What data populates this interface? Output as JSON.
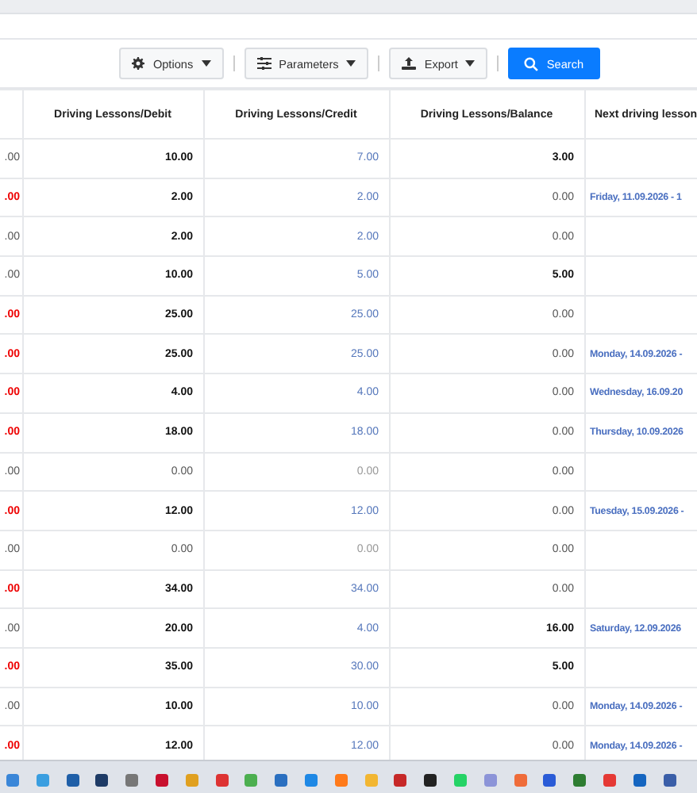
{
  "toolbar": {
    "buttons": [
      {
        "label": "Options",
        "kind": "dropdown"
      },
      {
        "label": "Parameters",
        "kind": "dropdown"
      },
      {
        "label": "Export",
        "kind": "dropdown"
      },
      {
        "label": "Search",
        "kind": "primary"
      }
    ]
  },
  "table": {
    "columns": [
      "Driving Lessons/Debit",
      "Driving Lessons/Credit",
      "Driving Lessons/Balance",
      "Next driving lesson"
    ],
    "rows": [
      {
        "column_0": {
          "text": ".00",
          "negative": false
        },
        "debit": {
          "text": "10.00",
          "emphasis": true
        },
        "credit": {
          "text": "7.00",
          "emphasis": true
        },
        "balance": {
          "text": "3.00",
          "emphasis": true
        }
      },
      {
        "column_0": {
          "text": ".00",
          "negative": true
        },
        "debit": {
          "text": "2.00",
          "emphasis": true
        },
        "credit": {
          "text": "2.00",
          "emphasis": true
        },
        "balance": {
          "text": "0.00",
          "emphasis": false
        },
        "next": "Friday, 11.09.2026 - 1"
      },
      {
        "column_0": {
          "text": ".00",
          "negative": false
        },
        "debit": {
          "text": "2.00",
          "emphasis": true
        },
        "credit": {
          "text": "2.00",
          "emphasis": true
        },
        "balance": {
          "text": "0.00",
          "emphasis": false
        }
      },
      {
        "column_0": {
          "text": ".00",
          "negative": false
        },
        "debit": {
          "text": "10.00",
          "emphasis": true
        },
        "credit": {
          "text": "5.00",
          "emphasis": true
        },
        "balance": {
          "text": "5.00",
          "emphasis": true
        }
      },
      {
        "column_0": {
          "text": ".00",
          "negative": true
        },
        "debit": {
          "text": "25.00",
          "emphasis": true
        },
        "credit": {
          "text": "25.00",
          "emphasis": true
        },
        "balance": {
          "text": "0.00",
          "emphasis": false
        }
      },
      {
        "column_0": {
          "text": ".00",
          "negative": true
        },
        "debit": {
          "text": "25.00",
          "emphasis": true
        },
        "credit": {
          "text": "25.00",
          "emphasis": true
        },
        "balance": {
          "text": "0.00",
          "emphasis": false
        },
        "next": "Monday, 14.09.2026 -"
      },
      {
        "column_0": {
          "text": ".00",
          "negative": true
        },
        "debit": {
          "text": "4.00",
          "emphasis": true
        },
        "credit": {
          "text": "4.00",
          "emphasis": true
        },
        "balance": {
          "text": "0.00",
          "emphasis": false
        },
        "next": "Wednesday, 16.09.20"
      },
      {
        "column_0": {
          "text": ".00",
          "negative": true
        },
        "debit": {
          "text": "18.00",
          "emphasis": true
        },
        "credit": {
          "text": "18.00",
          "emphasis": true
        },
        "balance": {
          "text": "0.00",
          "emphasis": false
        },
        "next": "Thursday, 10.09.2026"
      },
      {
        "column_0": {
          "text": ".00",
          "negative": false
        },
        "debit": {
          "text": "0.00",
          "emphasis": false
        },
        "credit": {
          "text": "0.00",
          "emphasis": false
        },
        "balance": {
          "text": "0.00",
          "emphasis": false
        }
      },
      {
        "column_0": {
          "text": ".00",
          "negative": true
        },
        "debit": {
          "text": "12.00",
          "emphasis": true
        },
        "credit": {
          "text": "12.00",
          "emphasis": true
        },
        "balance": {
          "text": "0.00",
          "emphasis": false
        },
        "next": "Tuesday, 15.09.2026 -"
      },
      {
        "column_0": {
          "text": ".00",
          "negative": false
        },
        "debit": {
          "text": "0.00",
          "emphasis": false
        },
        "credit": {
          "text": "0.00",
          "emphasis": false
        },
        "balance": {
          "text": "0.00",
          "emphasis": false
        }
      },
      {
        "column_0": {
          "text": ".00",
          "negative": true
        },
        "debit": {
          "text": "34.00",
          "emphasis": true
        },
        "credit": {
          "text": "34.00",
          "emphasis": true
        },
        "balance": {
          "text": "0.00",
          "emphasis": false
        }
      },
      {
        "column_0": {
          "text": ".00",
          "negative": false
        },
        "debit": {
          "text": "20.00",
          "emphasis": true
        },
        "credit": {
          "text": "4.00",
          "emphasis": true
        },
        "balance": {
          "text": "16.00",
          "emphasis": true
        },
        "next": "Saturday, 12.09.2026"
      },
      {
        "column_0": {
          "text": ".00",
          "negative": true
        },
        "debit": {
          "text": "35.00",
          "emphasis": true
        },
        "credit": {
          "text": "30.00",
          "emphasis": true
        },
        "balance": {
          "text": "5.00",
          "emphasis": true
        }
      },
      {
        "column_0": {
          "text": ".00",
          "negative": false
        },
        "debit": {
          "text": "10.00",
          "emphasis": true
        },
        "credit": {
          "text": "10.00",
          "emphasis": true
        },
        "balance": {
          "text": "0.00",
          "emphasis": false
        },
        "next": "Monday, 14.09.2026 -"
      },
      {
        "column_0": {
          "text": ".00",
          "negative": true
        },
        "debit": {
          "text": "12.00",
          "emphasis": true
        },
        "credit": {
          "text": "12.00",
          "emphasis": true
        },
        "balance": {
          "text": "0.00",
          "emphasis": false
        },
        "next": "Monday, 14.09.2026 -"
      }
    ]
  }
}
